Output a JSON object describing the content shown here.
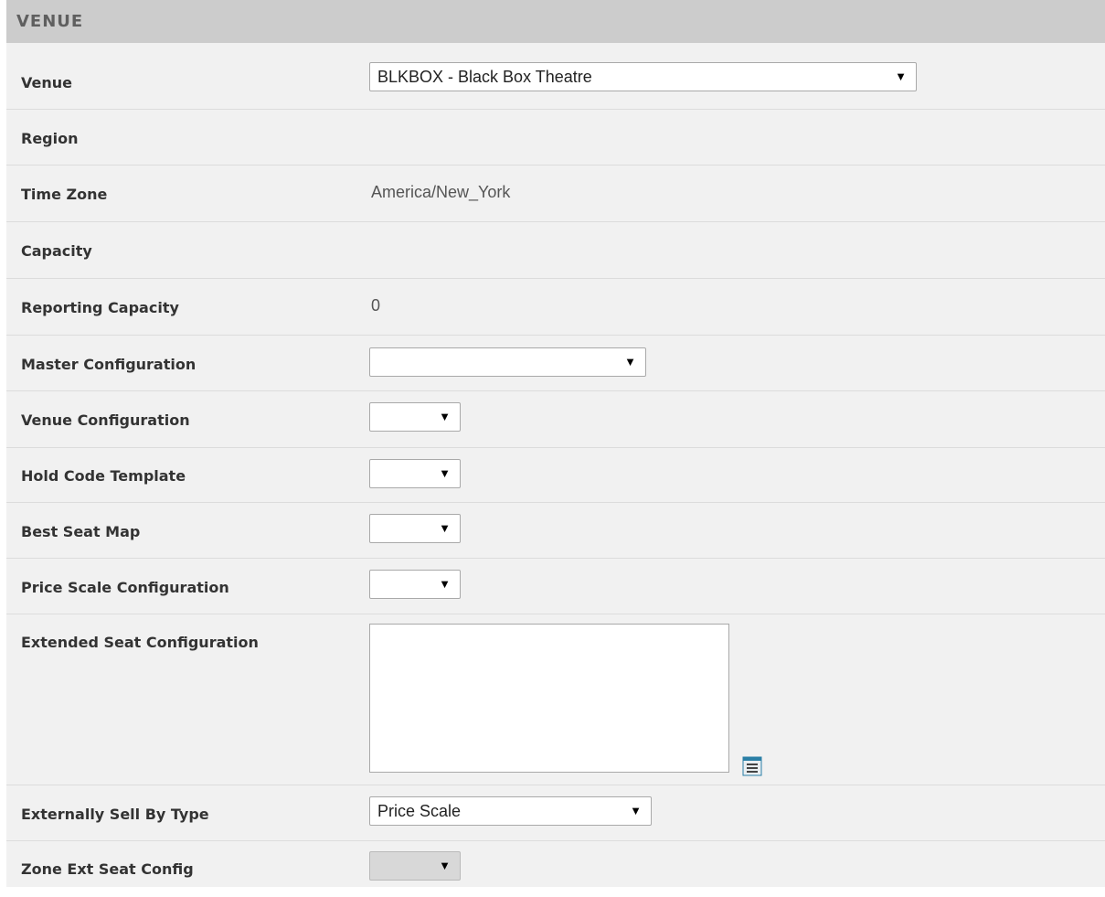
{
  "section": {
    "title": "VENUE"
  },
  "fields": {
    "venue": {
      "label": "Venue",
      "value": "BLKBOX - Black Box Theatre"
    },
    "region": {
      "label": "Region",
      "value": ""
    },
    "time_zone": {
      "label": "Time Zone",
      "value": "America/New_York"
    },
    "capacity": {
      "label": "Capacity",
      "value": ""
    },
    "reporting_capacity": {
      "label": "Reporting Capacity",
      "value": "0"
    },
    "master_configuration": {
      "label": "Master Configuration",
      "value": ""
    },
    "venue_configuration": {
      "label": "Venue Configuration",
      "value": ""
    },
    "hold_code_template": {
      "label": "Hold Code Template",
      "value": ""
    },
    "best_seat_map": {
      "label": "Best Seat Map",
      "value": ""
    },
    "price_scale_configuration": {
      "label": "Price Scale Configuration",
      "value": ""
    },
    "extended_seat_configuration": {
      "label": "Extended Seat Configuration",
      "value": ""
    },
    "externally_sell_by_type": {
      "label": "Externally Sell By Type",
      "value": "Price Scale"
    },
    "zone_ext_seat_config": {
      "label": "Zone Ext Seat Config",
      "value": ""
    }
  },
  "icons": {
    "dropdown_arrow": "▼",
    "list_editor": "list-icon"
  },
  "colors": {
    "header_bg": "#cccccc",
    "panel_bg": "#f1f1f1",
    "icon_accent": "#2a7fa6"
  }
}
